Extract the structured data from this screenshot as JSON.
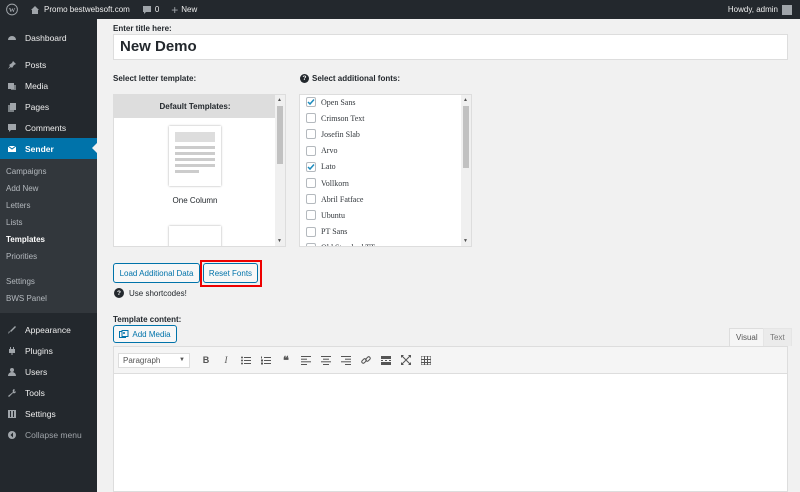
{
  "adminbar": {
    "site_name": "Promo bestwebsoft.com",
    "comments_count": "0",
    "new_label": "New",
    "greeting": "Howdy, admin"
  },
  "sidebar": {
    "items": [
      {
        "label": "Dashboard",
        "icon": "dashboard-icon"
      },
      {
        "label": "Posts",
        "icon": "pin-icon"
      },
      {
        "label": "Media",
        "icon": "media-icon"
      },
      {
        "label": "Pages",
        "icon": "pages-icon"
      },
      {
        "label": "Comments",
        "icon": "comment-icon"
      },
      {
        "label": "Sender",
        "icon": "mail-icon"
      }
    ],
    "submenu": [
      "Campaigns",
      "Add New",
      "Letters",
      "Lists",
      "Templates",
      "Priorities",
      "Settings",
      "BWS Panel"
    ],
    "bottom_items": [
      {
        "label": "Appearance",
        "icon": "brush-icon"
      },
      {
        "label": "Plugins",
        "icon": "plugin-icon"
      },
      {
        "label": "Users",
        "icon": "user-icon"
      },
      {
        "label": "Tools",
        "icon": "wrench-icon"
      },
      {
        "label": "Settings",
        "icon": "settings-icon"
      },
      {
        "label": "Collapse menu",
        "icon": "collapse-icon"
      }
    ]
  },
  "form": {
    "title_label": "Enter title here:",
    "title_value": "New Demo",
    "template_label": "Select letter template:",
    "default_templates": "Default Templates:",
    "template_name": "One Column",
    "fonts_label": "Select additional fonts:",
    "fonts": [
      {
        "name": "Open Sans",
        "checked": true
      },
      {
        "name": "Crimson Text",
        "checked": false
      },
      {
        "name": "Josefin Slab",
        "checked": false
      },
      {
        "name": "Arvo",
        "checked": false
      },
      {
        "name": "Lato",
        "checked": true
      },
      {
        "name": "Vollkorn",
        "checked": false
      },
      {
        "name": "Abril Fatface",
        "checked": false
      },
      {
        "name": "Ubuntu",
        "checked": false
      },
      {
        "name": "PT Sans",
        "checked": false
      },
      {
        "name": "Old Standard TT",
        "checked": false
      }
    ],
    "load_button": "Load Additional Data",
    "reset_button": "Reset Fonts",
    "shortcodes": "Use shortcodes!",
    "content_label": "Template content:",
    "add_media": "Add Media",
    "tab_visual": "Visual",
    "tab_text": "Text",
    "format_select": "Paragraph"
  },
  "colors": {
    "admin_dark": "#23282d",
    "accent": "#0073aa",
    "highlight": "#ee0000"
  }
}
